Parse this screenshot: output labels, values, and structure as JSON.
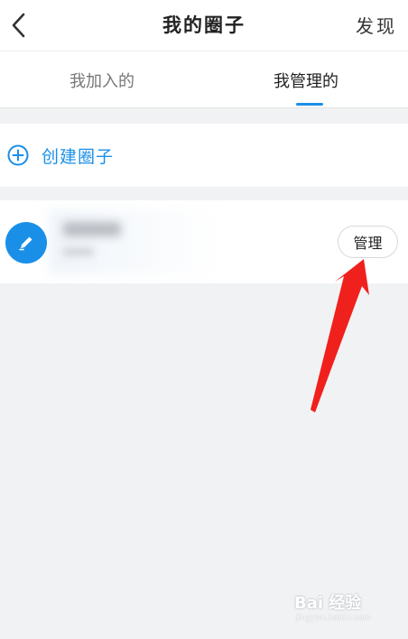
{
  "header": {
    "title": "我的圈子",
    "right_link": "发现",
    "back_icon": "chevron-left-icon"
  },
  "tabs": [
    {
      "label": "我加入的",
      "active": false
    },
    {
      "label": "我管理的",
      "active": true
    }
  ],
  "create": {
    "label": "创建圈子",
    "icon": "plus-circle-icon"
  },
  "circles": [
    {
      "icon": "pencil-icon",
      "action_label": "管理"
    }
  ],
  "colors": {
    "accent": "#1a8fe8",
    "annotation_arrow": "#f0211c",
    "background": "#f1f2f4"
  },
  "watermark": {
    "logo": "Bai 经验",
    "url": "jingyan.baidu.com"
  }
}
